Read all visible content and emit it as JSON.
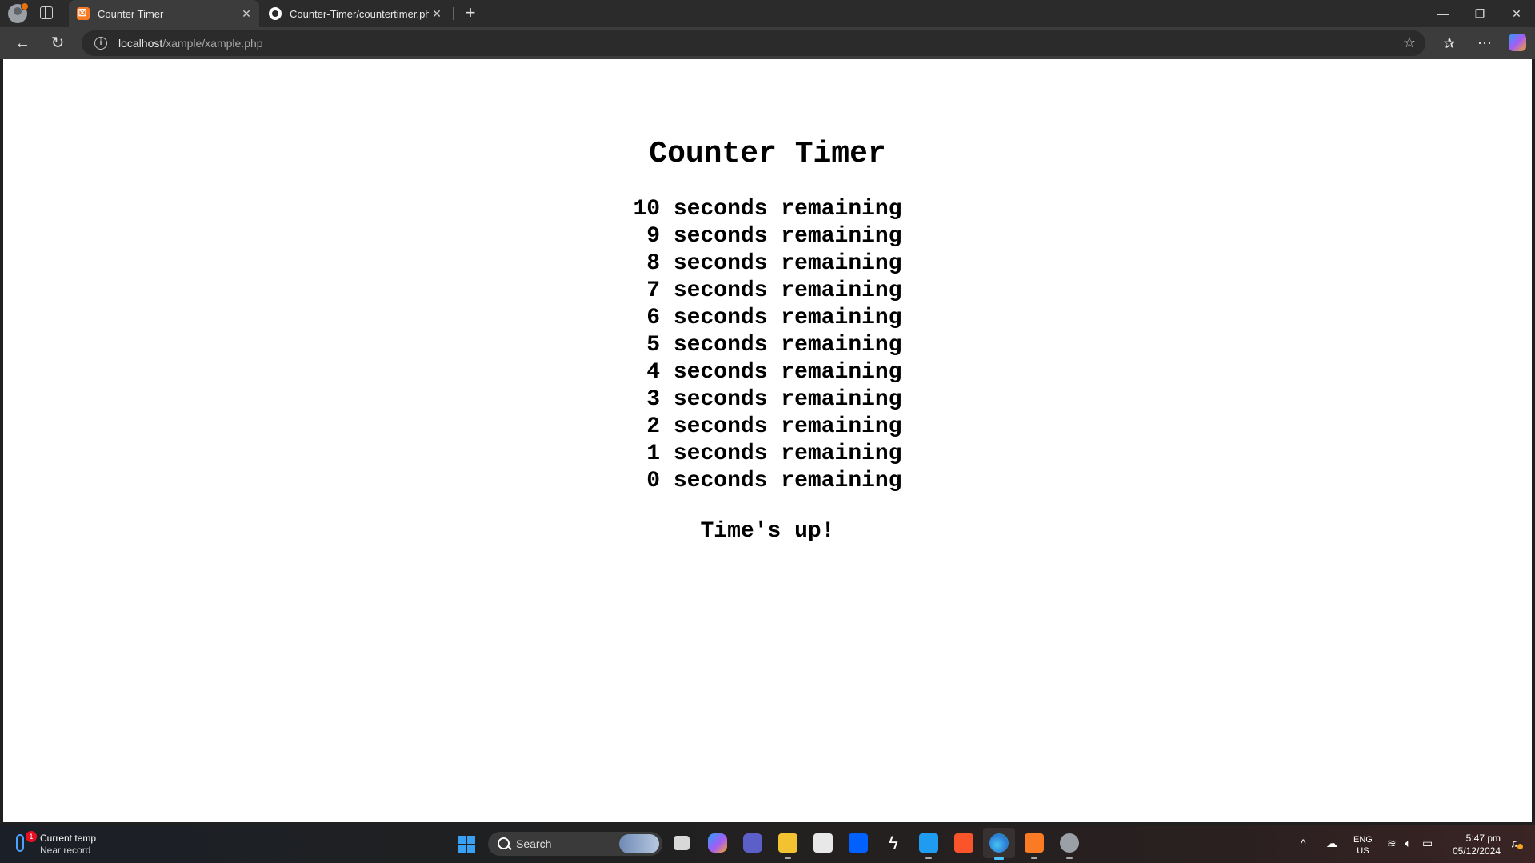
{
  "browser": {
    "tabs": [
      {
        "title": "Counter Timer",
        "icon": "xampp-icon",
        "active": true
      },
      {
        "title": "Counter-Timer/countertimer.php",
        "icon": "github-icon",
        "active": false
      }
    ],
    "address": {
      "host": "localhost",
      "path": "/xample/xample.php"
    }
  },
  "page": {
    "title": "Counter Timer",
    "countdown": [
      "10 seconds remaining",
      " 9 seconds remaining",
      " 8 seconds remaining",
      " 7 seconds remaining",
      " 6 seconds remaining",
      " 5 seconds remaining",
      " 4 seconds remaining",
      " 3 seconds remaining",
      " 2 seconds remaining",
      " 1 seconds remaining",
      " 0 seconds remaining"
    ],
    "final_message": "Time's up!"
  },
  "taskbar": {
    "weather": {
      "line1": "Current temp",
      "line2": "Near record",
      "badge": "1"
    },
    "search_placeholder": "Search",
    "language": {
      "line1": "ENG",
      "line2": "US"
    },
    "clock": {
      "time": "5:47 pm",
      "date": "05/12/2024"
    }
  },
  "colors": {
    "accent": "#4cc2ff",
    "page_bg": "#ffffff",
    "chrome_bg": "#2b2b2b"
  }
}
